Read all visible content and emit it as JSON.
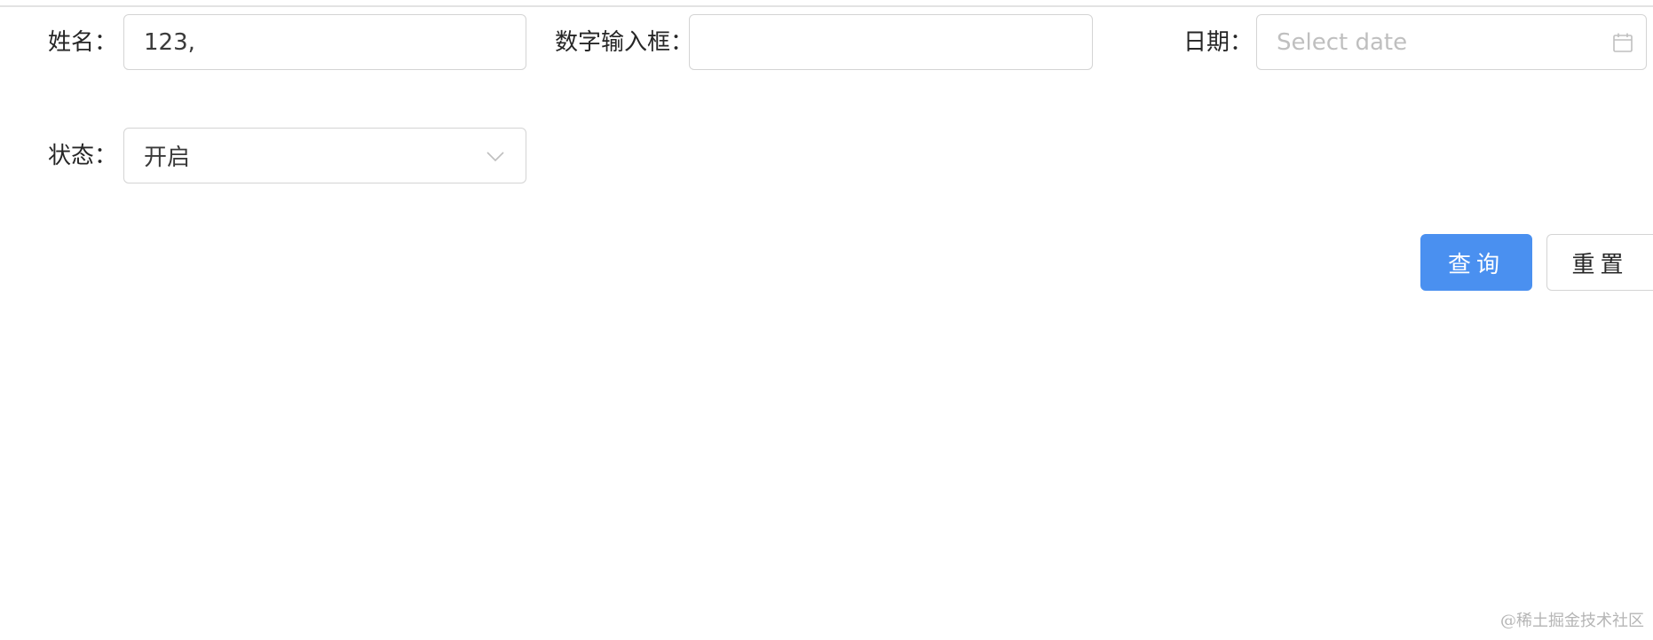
{
  "form": {
    "name": {
      "label": "姓名：",
      "value": "123,"
    },
    "number": {
      "label": "数字输入框：",
      "value": ""
    },
    "date": {
      "label": "日期：",
      "placeholder": "Select date",
      "icon": "calendar-icon"
    },
    "status": {
      "label": "状态：",
      "selected": "开启",
      "icon": "chevron-down-icon"
    }
  },
  "actions": {
    "query_label": "查询",
    "reset_label": "重置"
  },
  "colors": {
    "primary": "#4a90f0",
    "border": "#d4d4d4",
    "placeholder": "#bfbfbf"
  },
  "watermark": "@稀土掘金技术社区"
}
